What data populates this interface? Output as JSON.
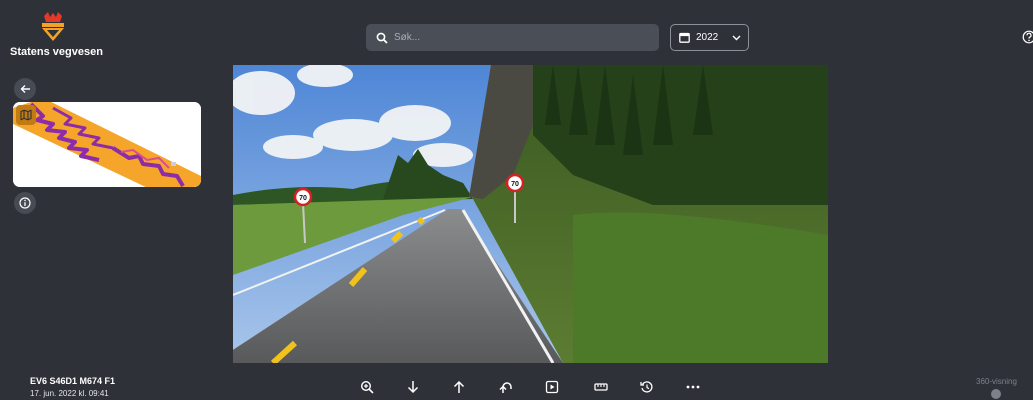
{
  "header": {
    "brand_name": "Statens vegvesen",
    "search": {
      "placeholder": "Søk..."
    },
    "year_select": {
      "value": "2022",
      "icon": "calendar-icon"
    },
    "help_icon": "help-icon"
  },
  "left_panel": {
    "back_icon": "arrow-left-icon",
    "map_toggle_icon": "map-icon",
    "info_icon": "info-icon"
  },
  "photo": {
    "speed_limit_signs": [
      "70",
      "70"
    ]
  },
  "footer": {
    "road_reference": "EV6 S46D1 M674 F1",
    "timestamp": "17. jun. 2022 kl. 09:41",
    "tools": [
      "zoom-in-icon",
      "arrow-down-icon",
      "arrow-up-icon",
      "turn-around-icon",
      "play-icon",
      "ruler-icon",
      "history-icon",
      "more-icon"
    ],
    "view360_label": "360-visning"
  },
  "colors": {
    "background": "#2e3138",
    "search_bg": "#4a4e57",
    "accent_orange": "#c27a12",
    "map_route": "#f4a52a",
    "map_marker": "#8e2ca8"
  }
}
